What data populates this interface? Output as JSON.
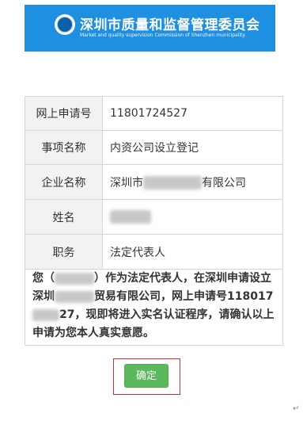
{
  "header": {
    "title": "深圳市质量和监督管理委员会",
    "subtitle": "Market and quality supervision Commission of Shenzhen municipality."
  },
  "table": {
    "rows": [
      {
        "label": "网上申请号",
        "value": "11801724527"
      },
      {
        "label": "事项名称",
        "value": "内资公司设立登记"
      },
      {
        "label": "企业名称",
        "value_prefix": "深圳市",
        "value_suffix": "有限公司"
      },
      {
        "label": "姓名",
        "value": ""
      },
      {
        "label": "职务",
        "value": "法定代表人"
      }
    ]
  },
  "notice": {
    "part1": "您（",
    "part2": "）作为法定代表人，在深圳申请设立深圳",
    "part3": "贸易有限公司，网上申请号",
    "part4": "118017",
    "part5": "27，现即将进入实名认证程序，请确认以上申请为您本人真实意愿。"
  },
  "confirm_label": "确定",
  "colors": {
    "header_bg": "#1f8fe0",
    "button_bg": "#5cb85c",
    "highlight_border": "#d9302c"
  }
}
